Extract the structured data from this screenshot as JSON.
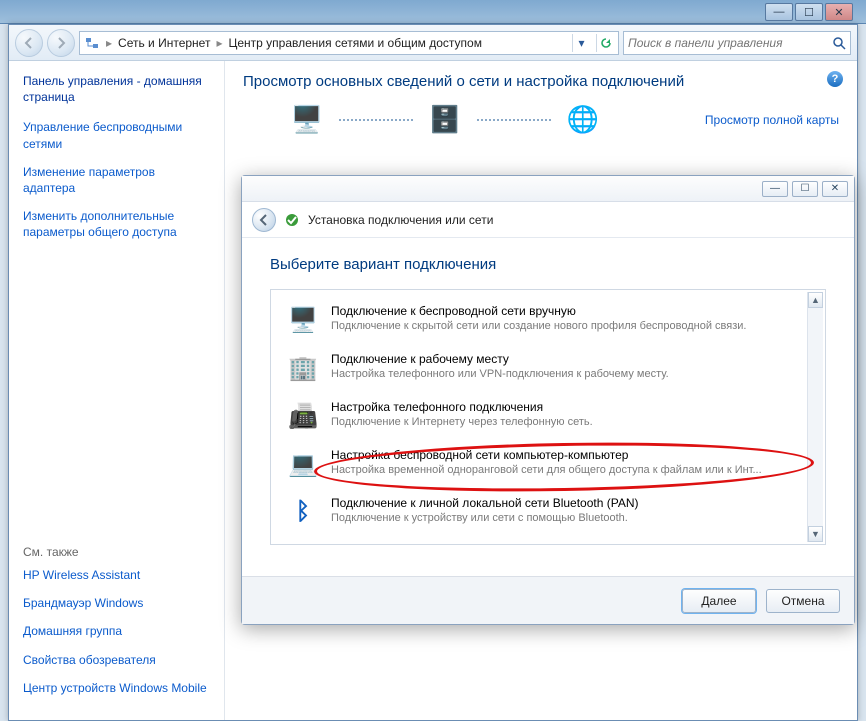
{
  "titlebar": {
    "min": "—",
    "max": "☐",
    "close": "✕"
  },
  "nav": {
    "crumb1": "Сеть и Интернет",
    "crumb2": "Центр управления сетями и общим доступом",
    "search_placeholder": "Поиск в панели управления"
  },
  "sidebar": {
    "home": "Панель управления - домашняя страница",
    "links": [
      "Управление беспроводными сетями",
      "Изменение параметров адаптера",
      "Изменить дополнительные параметры общего доступа"
    ],
    "see_also_label": "См. также",
    "see_also": [
      "HP Wireless Assistant",
      "Брандмауэр Windows",
      "Домашняя группа",
      "Свойства обозревателя",
      "Центр устройств Windows Mobile"
    ]
  },
  "main": {
    "title": "Просмотр основных сведений о сети и настройка подключений",
    "full_map": "Просмотр полной карты"
  },
  "dialog": {
    "window_title": "Установка подключения или сети",
    "heading": "Выберите вариант подключения",
    "options": [
      {
        "title": "Подключение к беспроводной сети вручную",
        "desc": "Подключение к скрытой сети или создание нового профиля беспроводной связи.",
        "icon": "🖥️"
      },
      {
        "title": "Подключение к рабочему месту",
        "desc": "Настройка телефонного или VPN-подключения к рабочему месту.",
        "icon": "🏢"
      },
      {
        "title": "Настройка телефонного подключения",
        "desc": "Подключение к Интернету через телефонную сеть.",
        "icon": "📠"
      },
      {
        "title": "Настройка беспроводной сети компьютер-компьютер",
        "desc": "Настройка временной одноранговой сети для общего доступа к файлам или к Инт...",
        "icon": "💻"
      },
      {
        "title": "Подключение к личной локальной сети Bluetooth (PAN)",
        "desc": "Подключение к устройству или сети с помощью Bluetooth.",
        "icon": "ᛒ"
      }
    ],
    "next": "Далее",
    "cancel": "Отмена"
  }
}
